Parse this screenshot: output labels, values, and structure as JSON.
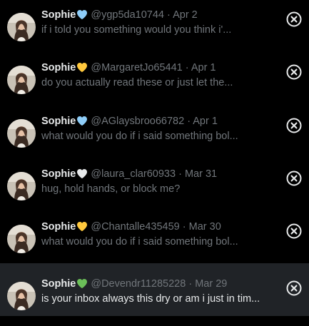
{
  "colors": {
    "background": "#000000",
    "selected_row": "#202327",
    "name_text": "#e7e9ea",
    "muted_text": "#71767b",
    "heart_blue": "#8ecdf8",
    "heart_yellow": "#ffc83d",
    "heart_white": "#e7e9ea",
    "heart_green": "#6bbf59"
  },
  "conversations": [
    {
      "name": "Sophie",
      "heart_icon": "blue-heart-icon",
      "heart_color": "#8ecdf8",
      "handle": "@ygp5da10744",
      "separator": "·",
      "date": "Apr 2",
      "preview": "if i told you something would you think i'...",
      "selected": false
    },
    {
      "name": "Sophie",
      "heart_icon": "yellow-heart-icon",
      "heart_color": "#ffc83d",
      "handle": "@MargaretJo65441",
      "separator": "·",
      "date": "Apr 1",
      "preview": "do you actually read these or just let the...",
      "selected": false
    },
    {
      "name": "Sophie",
      "heart_icon": "blue-heart-icon",
      "heart_color": "#8ecdf8",
      "handle": "@AGlaysbroo66782",
      "separator": "·",
      "date": "Apr 1",
      "preview": "what would you do if i said something bol...",
      "selected": false
    },
    {
      "name": "Sophie",
      "heart_icon": "white-heart-icon",
      "heart_color": "#e7e9ea",
      "handle": "@laura_clar60933",
      "separator": "·",
      "date": "Mar 31",
      "preview": "hug, hold hands, or block me?",
      "selected": false
    },
    {
      "name": "Sophie",
      "heart_icon": "yellow-heart-icon",
      "heart_color": "#ffc83d",
      "handle": "@Chantalle435459",
      "separator": "·",
      "date": "Mar 30",
      "preview": "what would you do if i said something bol...",
      "selected": false
    },
    {
      "name": "Sophie",
      "heart_icon": "green-heart-icon",
      "heart_color": "#6bbf59",
      "handle": "@Devendr11285228",
      "separator": "·",
      "date": "Mar 29",
      "preview": "is your inbox always this dry or am i just in tim...",
      "selected": true
    }
  ]
}
